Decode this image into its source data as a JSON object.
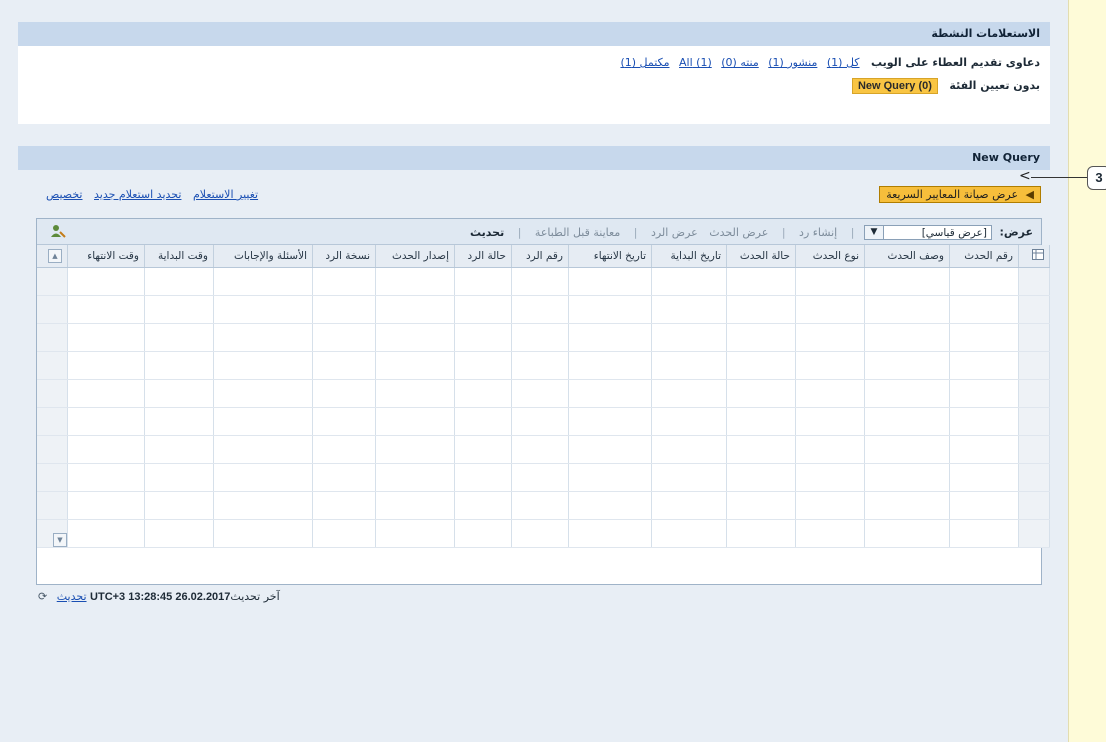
{
  "active_queries": {
    "title": "الاستعلامات النشطة",
    "row1_label": "دعاوى تقديم العطاء على الويب",
    "row1_links": [
      "كل (1)",
      "منشور (1)",
      "منته (0)",
      "(1) All",
      "مكتمل (1)"
    ],
    "row2_label": "بدون تعيين الفئة",
    "row2_badge": "New Query (0)"
  },
  "new_query": {
    "title": "New Query",
    "quick_criteria_button": "عرض صيانة المعايير السريعة",
    "top_links": [
      "تغيير الاستعلام",
      "تحديد استعلام جديد",
      "تخصيص"
    ],
    "callout_number": "3"
  },
  "toolbar": {
    "view_label": "عرض:",
    "view_value": "[عرض قياسي]",
    "create_response": "إنشاء رد",
    "display_event": "عرض الحدث",
    "display_response": "عرض الرد",
    "print_preview": "معاينة قبل الطباعة",
    "refresh": "تحديث"
  },
  "table": {
    "columns": [
      "رقم الحدث",
      "وصف الحدث",
      "نوع الحدث",
      "حالة الحدث",
      "تاريخ البداية",
      "تاريخ الانتهاء",
      "رقم الرد",
      "حالة الرد",
      "إصدار الحدث",
      "نسخة الرد",
      "الأسئلة والإجابات",
      "وقت البداية",
      "وقت الانتهاء"
    ],
    "row_count": 10
  },
  "footer": {
    "last_refresh_label": "آخر تحديث",
    "timestamp": "26.02.2017 13:28:45 UTC+3",
    "refresh_link": "تحديث"
  },
  "icons": {
    "collapse_arrow": "triangle-left-icon",
    "settings": "table-settings-icon",
    "user": "user-settings-icon",
    "scroll_up": "scroll-up-icon",
    "scroll_down": "scroll-down-icon",
    "refresh_footer": "refresh-icon"
  }
}
